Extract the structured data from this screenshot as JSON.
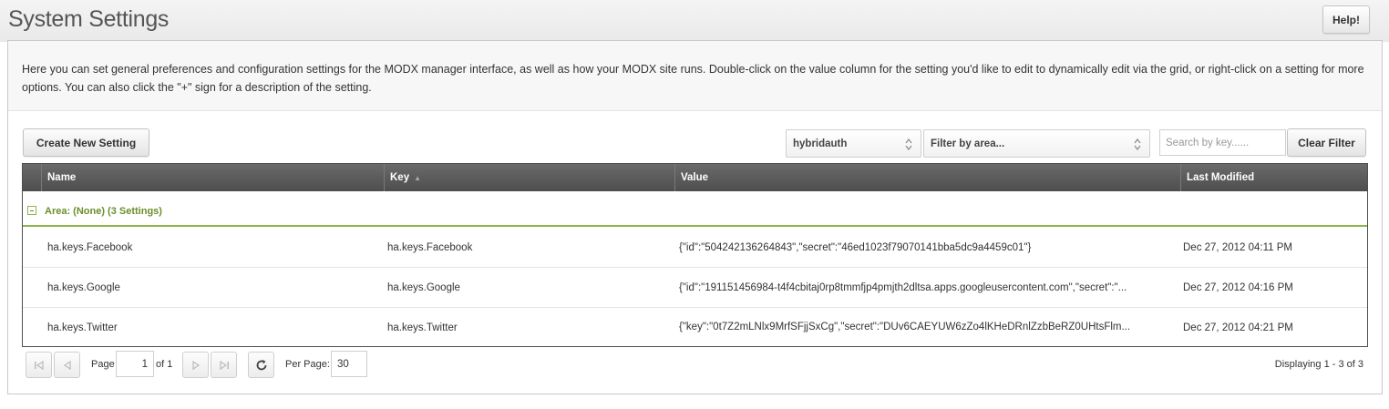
{
  "page": {
    "title": "System Settings",
    "help_label": "Help!",
    "description": "Here you can set general preferences and configuration settings for the MODX manager interface, as well as how your MODX site runs. Double-click on the value column for the setting you'd like to edit to dynamically edit via the grid, or right-click on a setting for more options. You can also click the \"+\" sign for a description of the setting."
  },
  "toolbar": {
    "create_label": "Create New Setting",
    "namespace_value": "hybridauth",
    "area_placeholder": "Filter by area...",
    "search_placeholder": "Search by key......",
    "clear_label": "Clear Filter"
  },
  "grid": {
    "columns": [
      "Name",
      "Key",
      "Value",
      "Last Modified"
    ],
    "sort_indicator": "▲",
    "group_label": "Area: (None) (3 Settings)",
    "rows": [
      {
        "name": "ha.keys.Facebook",
        "key": "ha.keys.Facebook",
        "value": "{\"id\":\"504242136264843\",\"secret\":\"46ed1023f79070141bba5dc9a4459c01\"}",
        "modified": "Dec 27, 2012 04:11 PM"
      },
      {
        "name": "ha.keys.Google",
        "key": "ha.keys.Google",
        "value": "{\"id\":\"191151456984-t4f4cbitaj0rp8tmmfjp4pmjth2dltsa.apps.googleusercontent.com\",\"secret\":\"...",
        "modified": "Dec 27, 2012 04:16 PM"
      },
      {
        "name": "ha.keys.Twitter",
        "key": "ha.keys.Twitter",
        "value": "{\"key\":\"0t7Z2mLNlx9MrfSFjjSxCg\",\"secret\":\"DUv6CAEYUW6zZo4lKHeDRnlZzbBeRZ0UHtsFlm...",
        "modified": "Dec 27, 2012 04:21 PM"
      }
    ]
  },
  "pager": {
    "page_label": "Page",
    "page_value": "1",
    "of_label": "of 1",
    "per_page_label": "Per Page:",
    "per_page_value": "30",
    "displaying": "Displaying 1 - 3 of 3"
  },
  "icons": {
    "first": "first-page-icon",
    "prev": "prev-page-icon",
    "next": "next-page-icon",
    "last": "last-page-icon",
    "refresh": "refresh-icon",
    "collapse": "collapse-icon"
  },
  "colors": {
    "group_accent": "#8eb34d",
    "header_bg": "#555555"
  }
}
